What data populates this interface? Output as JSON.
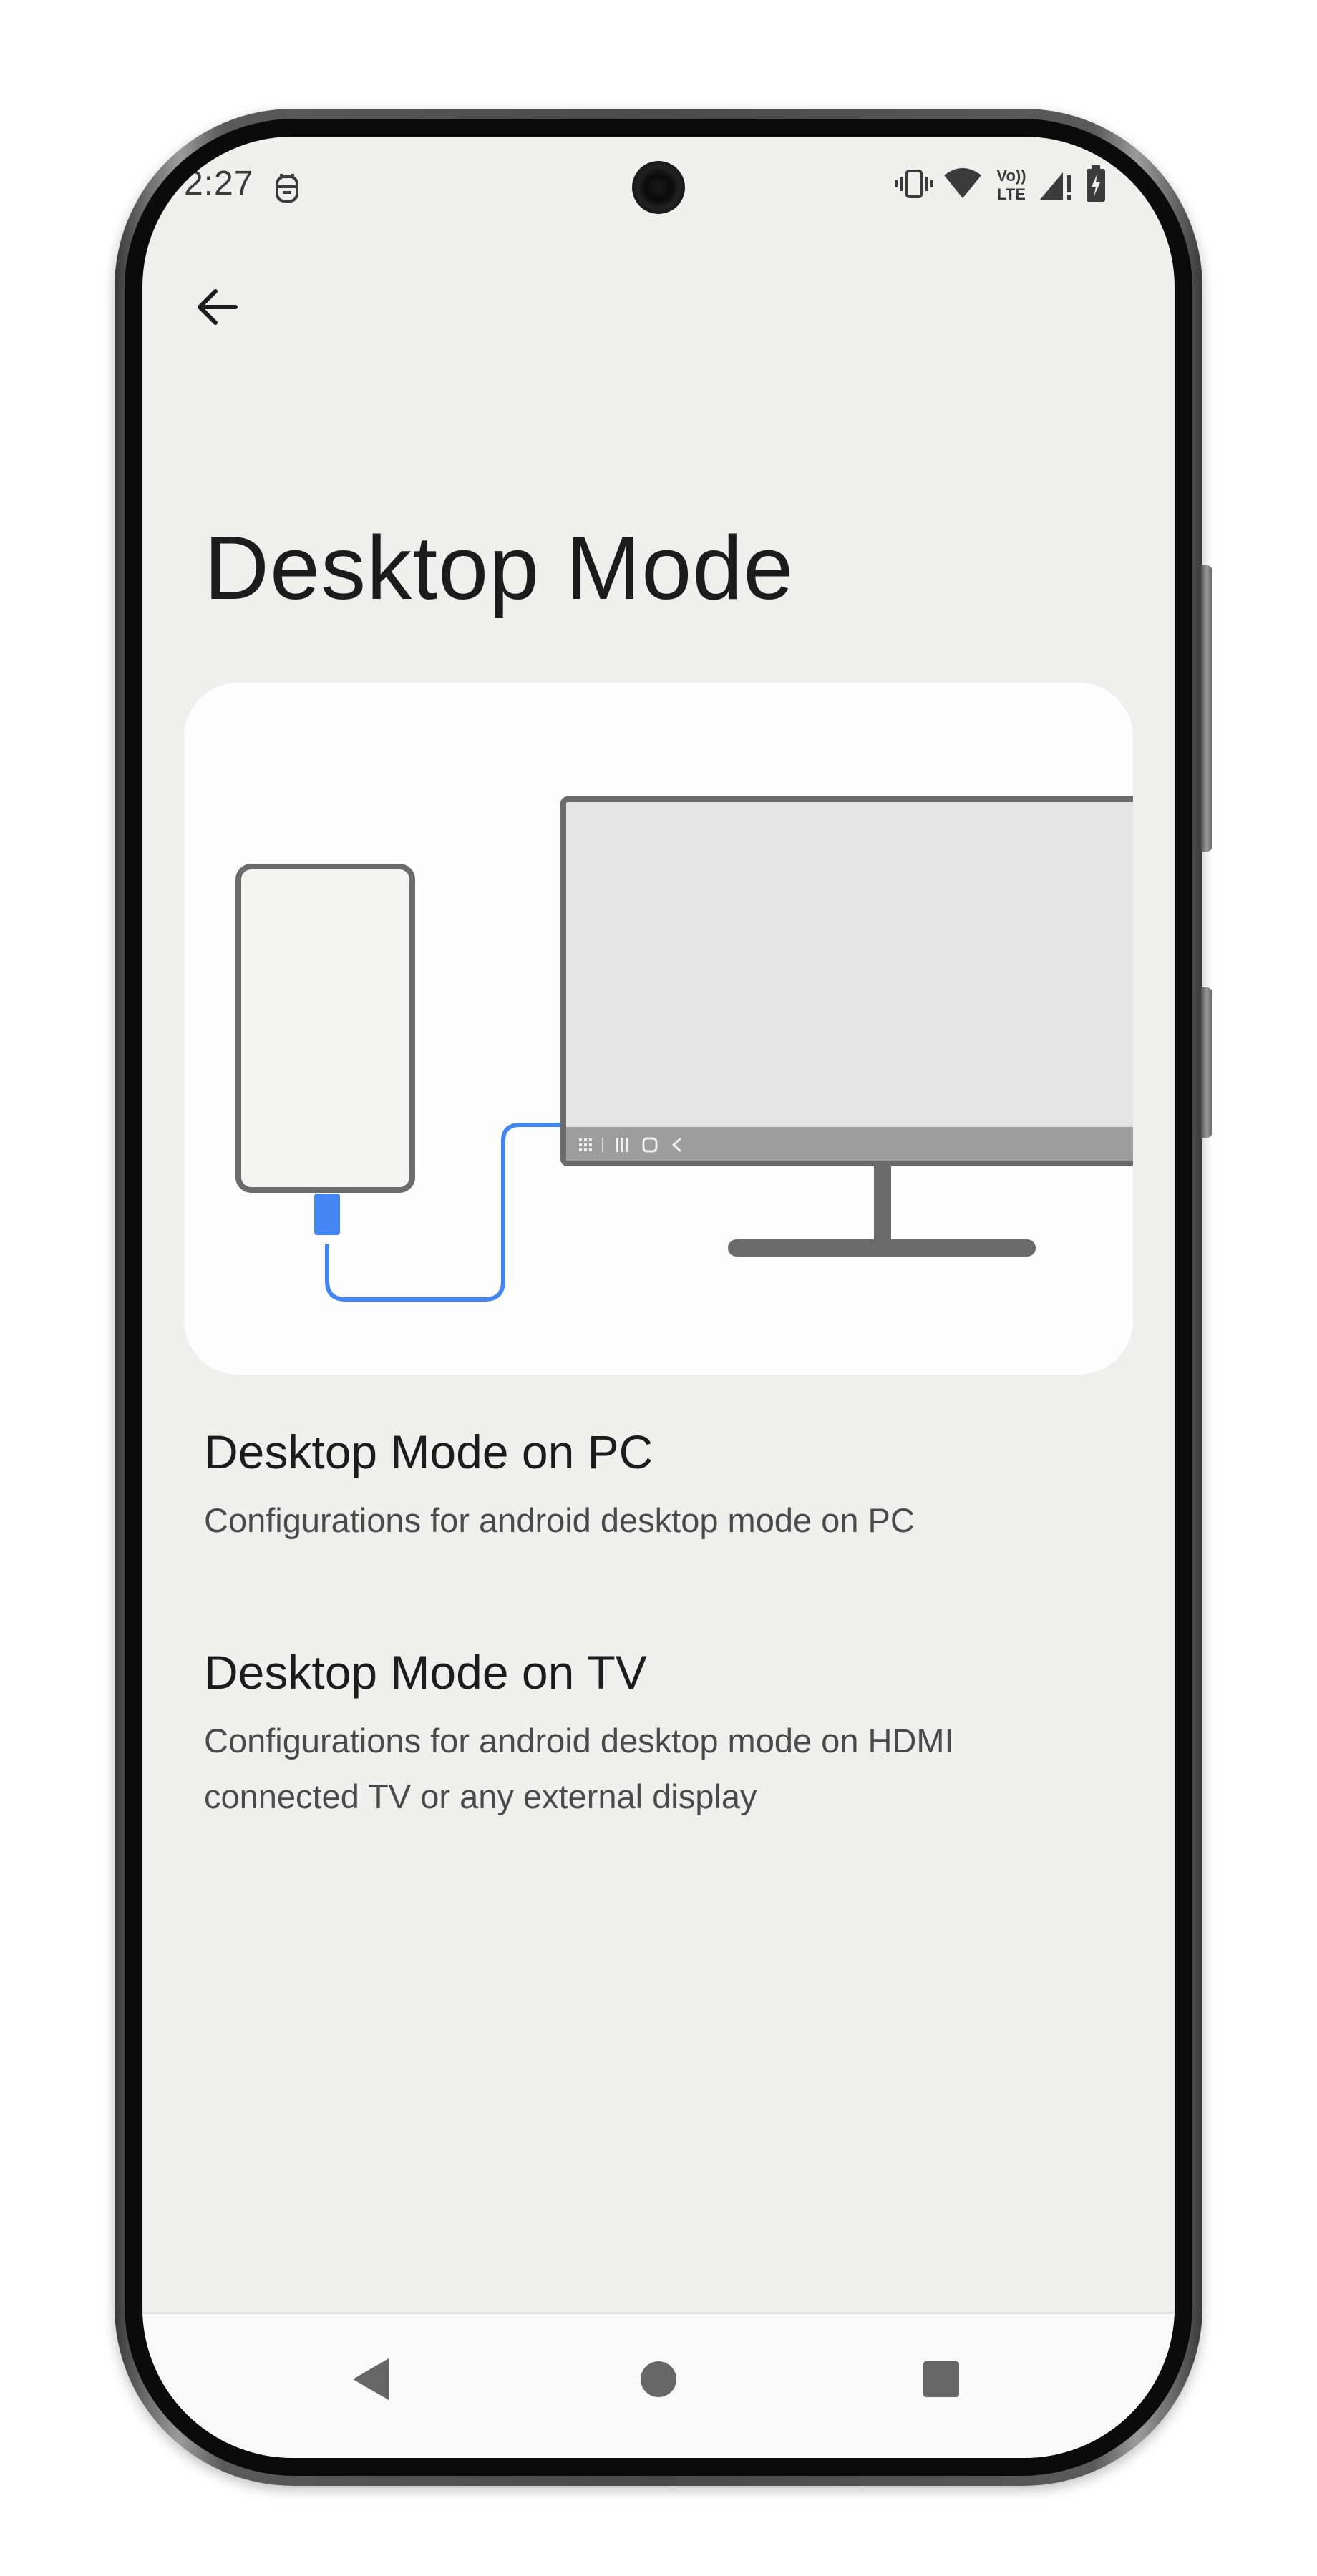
{
  "status_bar": {
    "time": "2:27",
    "icons": [
      "notification-icon",
      "vibrate-icon",
      "wifi-icon",
      "volte-icon",
      "signal-icon",
      "battery-charging-icon"
    ],
    "volte_top": "Vo))",
    "volte_bottom": "LTE"
  },
  "app_bar": {
    "back_icon": "arrow-back-icon"
  },
  "page": {
    "title": "Desktop Mode"
  },
  "illustration": {
    "accent_color": "#4285f4",
    "frame_color": "#6b6b6b",
    "monitor_screen_color": "#e4e4e4"
  },
  "preferences": [
    {
      "title": "Desktop Mode on PC",
      "summary": "Configurations for android desktop mode on PC"
    },
    {
      "title": "Desktop Mode on TV",
      "summary": "Configurations for android desktop mode on HDMI connected TV or any external display"
    }
  ],
  "nav_bar": {
    "buttons": [
      "back-triangle-icon",
      "home-circle-icon",
      "recents-square-icon"
    ]
  }
}
